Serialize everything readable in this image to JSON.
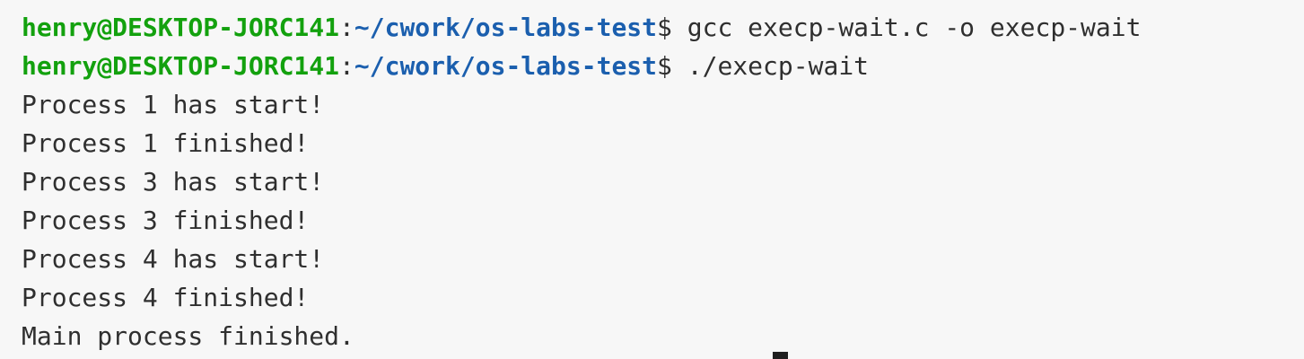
{
  "terminal": {
    "scroll_remnant": "  ┘",
    "prompts": [
      {
        "user_host": "henry@DESKTOP-JORC141",
        "colon": ":",
        "path": "~/cwork/os-labs-test",
        "dollar": "$",
        "command": " gcc execp-wait.c -o execp-wait"
      },
      {
        "user_host": "henry@DESKTOP-JORC141",
        "colon": ":",
        "path": "~/cwork/os-labs-test",
        "dollar": "$",
        "command": " ./execp-wait"
      }
    ],
    "output": [
      "Process 1 has start!",
      "Process 1 finished!",
      "Process 3 has start!",
      "Process 3 finished!",
      "Process 4 has start!",
      "Process 4 finished!",
      "Main process finished."
    ]
  },
  "colors": {
    "background": "#f7f7f7",
    "text": "#2f2f2f",
    "user_host": "#13a10e",
    "path": "#1b5fae",
    "cursor": "#1f1f1f"
  }
}
